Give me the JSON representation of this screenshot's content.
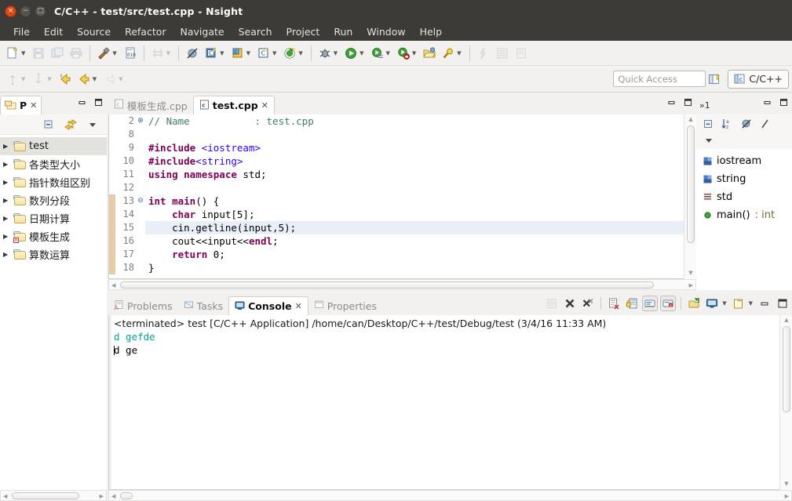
{
  "window": {
    "title": "C/C++ - test/src/test.cpp - Nsight",
    "controls": {
      "close": "×",
      "minimize": "−",
      "maximize": "□"
    }
  },
  "menubar": {
    "items": [
      {
        "label": "File"
      },
      {
        "label": "Edit"
      },
      {
        "label": "Source"
      },
      {
        "label": "Refactor"
      },
      {
        "label": "Navigate"
      },
      {
        "label": "Search"
      },
      {
        "label": "Project"
      },
      {
        "label": "Run"
      },
      {
        "label": "Window"
      },
      {
        "label": "Help"
      }
    ]
  },
  "toolbar": {
    "row1": [
      {
        "name": "new-file",
        "glyph": "὜b",
        "arrow": true,
        "enabled": true
      },
      {
        "name": "save",
        "glyph": "Ὃe",
        "arrow": false,
        "enabled": false
      },
      {
        "name": "save-all",
        "glyph": "὚b",
        "arrow": false,
        "enabled": false
      },
      {
        "name": "print",
        "glyph": "⎙",
        "arrow": false,
        "enabled": false
      },
      {
        "sep": true
      },
      {
        "name": "build",
        "glyph": "ὒ8",
        "arrow": true,
        "enabled": true
      },
      {
        "name": "build-configurations",
        "glyph": "010",
        "arrow": false,
        "enabled": true
      },
      {
        "sep": true
      },
      {
        "name": "open-element",
        "glyph": "⌗",
        "arrow": true,
        "enabled": false
      },
      {
        "sep": true
      },
      {
        "name": "skip-breakpoints",
        "glyph": "╱",
        "arrow": false,
        "enabled": true
      },
      {
        "name": "new-c-project",
        "glyph": "C",
        "arrow": true,
        "enabled": true
      },
      {
        "name": "new-cpp-class",
        "glyph": "C",
        "arrow": true,
        "enabled": true
      },
      {
        "name": "new-c-source",
        "glyph": "C",
        "arrow": true,
        "enabled": true
      },
      {
        "name": "cuda-new",
        "glyph": "G",
        "arrow": true,
        "enabled": true
      },
      {
        "sep": true
      },
      {
        "name": "debug",
        "glyph": "ὁe",
        "arrow": true,
        "enabled": true
      },
      {
        "name": "run",
        "glyph": "▶",
        "arrow": true,
        "enabled": true
      },
      {
        "name": "profile",
        "glyph": "▶",
        "arrow": true,
        "enabled": true
      },
      {
        "name": "run-last-tool",
        "glyph": "▶",
        "arrow": true,
        "enabled": true
      },
      {
        "name": "open-folder",
        "glyph": "Ὄ2",
        "arrow": false,
        "enabled": true
      },
      {
        "name": "search",
        "glyph": "ὐd",
        "arrow": true,
        "enabled": true
      },
      {
        "sep": true
      },
      {
        "name": "next-annotation",
        "glyph": "⚡",
        "arrow": false,
        "enabled": false
      },
      {
        "name": "toggle-block-selection",
        "glyph": "☰",
        "arrow": false,
        "enabled": false
      },
      {
        "name": "toggle-mark-occurrences",
        "glyph": "⬚",
        "arrow": false,
        "enabled": false
      }
    ],
    "row2": [
      {
        "name": "previous-edit-location",
        "glyph": "⤴",
        "arrow": true,
        "enabled": false
      },
      {
        "name": "next-edit-location",
        "glyph": "⤵",
        "arrow": true,
        "enabled": false
      },
      {
        "name": "back",
        "glyph": "←",
        "arrow": false,
        "enabled": true
      },
      {
        "name": "forward",
        "glyph": "→",
        "arrow": true,
        "enabled": true
      },
      {
        "name": "pin-editor",
        "glyph": "↺",
        "arrow": true,
        "enabled": false
      }
    ],
    "quick_access_placeholder": "Quick Access",
    "new_perspective_label": "",
    "perspective_label": "C/C++"
  },
  "project_explorer": {
    "tab_label": "P",
    "close_glyph": "✕",
    "minimize_glyph": "−",
    "maximize_glyph": "□",
    "toolbar": [
      {
        "name": "collapse-all",
        "glyph": "⊟"
      },
      {
        "name": "link-with-editor",
        "glyph": "⇄"
      },
      {
        "name": "view-menu",
        "glyph": "▽"
      }
    ],
    "items": [
      {
        "label": "test",
        "selected": true,
        "error": false
      },
      {
        "label": "各类型大小",
        "selected": false,
        "error": false
      },
      {
        "label": "指针数组区别",
        "selected": false,
        "error": false
      },
      {
        "label": "数列分段",
        "selected": false,
        "error": false
      },
      {
        "label": "日期计算",
        "selected": false,
        "error": false
      },
      {
        "label": "模板生成",
        "selected": false,
        "error": true
      },
      {
        "label": "算数运算",
        "selected": false,
        "error": false
      }
    ]
  },
  "editor": {
    "tabs": [
      {
        "label": "模板生成.cpp",
        "active": false,
        "closable": false
      },
      {
        "label": "test.cpp",
        "active": true,
        "closable": true,
        "close_glyph": "✕"
      }
    ],
    "minimize_glyph": "−",
    "maximize_glyph": "□",
    "lines": [
      {
        "num": "2",
        "fold": "⊕",
        "changed": false,
        "highlight": false,
        "tokens": [
          {
            "t": "// Name           : test.cpp",
            "c": "cm"
          }
        ]
      },
      {
        "num": "8",
        "fold": "",
        "changed": false,
        "highlight": false,
        "tokens": []
      },
      {
        "num": "9",
        "fold": "",
        "changed": false,
        "highlight": false,
        "tokens": [
          {
            "t": "#include ",
            "c": "pp"
          },
          {
            "t": "<iostream>",
            "c": "str"
          }
        ]
      },
      {
        "num": "10",
        "fold": "",
        "changed": false,
        "highlight": false,
        "tokens": [
          {
            "t": "#include",
            "c": "pp"
          },
          {
            "t": "<string>",
            "c": "str"
          }
        ]
      },
      {
        "num": "11",
        "fold": "",
        "changed": false,
        "highlight": false,
        "tokens": [
          {
            "t": "using namespace ",
            "c": "k"
          },
          {
            "t": "std;",
            "c": ""
          }
        ]
      },
      {
        "num": "12",
        "fold": "",
        "changed": false,
        "highlight": false,
        "tokens": []
      },
      {
        "num": "13",
        "fold": "⊖",
        "changed": true,
        "highlight": false,
        "tokens": [
          {
            "t": "int ",
            "c": "k"
          },
          {
            "t": "main",
            "c": "kb"
          },
          {
            "t": "() {",
            "c": ""
          }
        ]
      },
      {
        "num": "14",
        "fold": "",
        "changed": true,
        "highlight": false,
        "tokens": [
          {
            "t": "    ",
            "c": ""
          },
          {
            "t": "char ",
            "c": "k"
          },
          {
            "t": "input[5];",
            "c": ""
          }
        ]
      },
      {
        "num": "15",
        "fold": "",
        "changed": true,
        "highlight": true,
        "tokens": [
          {
            "t": "    cin.getline(input,5);",
            "c": ""
          }
        ]
      },
      {
        "num": "16",
        "fold": "",
        "changed": true,
        "highlight": false,
        "tokens": [
          {
            "t": "    cout<<input<<",
            "c": ""
          },
          {
            "t": "endl",
            "c": "kb"
          },
          {
            "t": ";",
            "c": ""
          }
        ]
      },
      {
        "num": "17",
        "fold": "",
        "changed": true,
        "highlight": false,
        "tokens": [
          {
            "t": "    ",
            "c": ""
          },
          {
            "t": "return ",
            "c": "k"
          },
          {
            "t": "0;",
            "c": ""
          }
        ]
      },
      {
        "num": "18",
        "fold": "",
        "changed": true,
        "highlight": false,
        "tokens": [
          {
            "t": "}",
            "c": ""
          }
        ]
      }
    ]
  },
  "outline": {
    "tab_label": "»1",
    "minimize_glyph": "−",
    "maximize_glyph": "□",
    "toolbar": [
      {
        "name": "collapse-all",
        "glyph": "⊟"
      },
      {
        "name": "sort",
        "glyph": "↓az"
      },
      {
        "name": "hide-fields",
        "glyph": "⊘"
      },
      {
        "name": "hide-static",
        "glyph": "╱"
      }
    ],
    "toolbar2": [
      {
        "name": "view-menu",
        "glyph": "▽"
      }
    ],
    "items": [
      {
        "label": "iostream",
        "kind": "include",
        "ret": ""
      },
      {
        "label": "string",
        "kind": "include",
        "ret": ""
      },
      {
        "label": "std",
        "kind": "namespace",
        "ret": ""
      },
      {
        "label": "main()",
        "kind": "function",
        "ret": " : int"
      }
    ]
  },
  "console": {
    "tabs": [
      {
        "label": "Problems",
        "active": false,
        "icon": "problems-icon"
      },
      {
        "label": "Tasks",
        "active": false,
        "icon": "tasks-icon"
      },
      {
        "label": "Console",
        "active": true,
        "icon": "console-icon",
        "close_glyph": "✕"
      },
      {
        "label": "Properties",
        "active": false,
        "icon": "properties-icon"
      }
    ],
    "toolbar": [
      {
        "name": "clear-console",
        "glyph": "⬚",
        "enabled": false,
        "pressed": false
      },
      {
        "name": "terminate",
        "glyph": "✖",
        "enabled": true,
        "pressed": false
      },
      {
        "name": "remove-all-terminated",
        "glyph": "✖",
        "enabled": true,
        "pressed": false
      },
      {
        "sep": true
      },
      {
        "name": "clear",
        "glyph": "Ὕ1",
        "enabled": true,
        "pressed": false
      },
      {
        "name": "scroll-lock",
        "glyph": "ὑ2",
        "enabled": true,
        "pressed": false
      },
      {
        "name": "show-console-on-output",
        "glyph": "Ὓ5",
        "enabled": true,
        "pressed": true
      },
      {
        "name": "show-console-on-error",
        "glyph": "Ὓ5",
        "enabled": true,
        "pressed": true
      },
      {
        "sep": true
      },
      {
        "name": "pin-console",
        "glyph": "➦",
        "enabled": true,
        "pressed": false
      },
      {
        "name": "display-selected-console",
        "glyph": "Ὓ5",
        "enabled": true,
        "pressed": false,
        "arrow": true
      },
      {
        "name": "open-console",
        "glyph": "὜b",
        "enabled": true,
        "pressed": false,
        "arrow": true
      },
      {
        "name": "minimize",
        "glyph": "−",
        "enabled": true,
        "pressed": false
      },
      {
        "name": "maximize",
        "glyph": "□",
        "enabled": true,
        "pressed": false
      }
    ],
    "header": "<terminated> test [C/C++ Application] /home/can/Desktop/C++/test/Debug/test (3/4/16 11:33 AM)",
    "output": [
      {
        "text": "d gefde",
        "color": "green",
        "caret": false
      },
      {
        "text": "d ge",
        "color": "black",
        "caret": true
      }
    ]
  },
  "colors": {
    "titlebar_bg": "#3c3b37",
    "chrome_bg": "#f2f1f0",
    "editor_bg": "#ffffff",
    "keyword": "#7f0055",
    "string": "#2a00ff",
    "comment": "#3f7f5f",
    "highlight_line": "#e8eff7",
    "change_bar": "#e8cba8",
    "console_green": "#00a98f",
    "close_button": "#dd4814"
  }
}
